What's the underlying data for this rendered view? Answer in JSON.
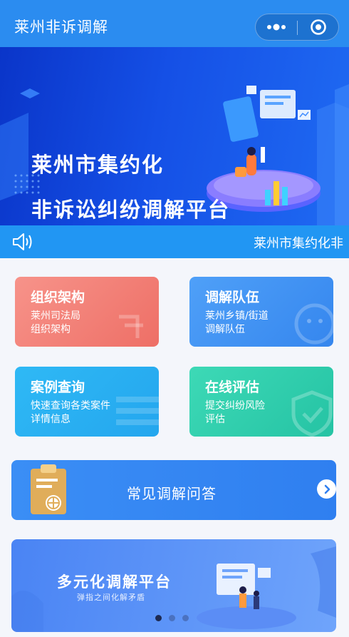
{
  "header": {
    "title": "莱州非诉调解"
  },
  "capsule": {
    "more_icon": "more-dots-icon",
    "close_icon": "target-close-icon"
  },
  "banner": {
    "line1": "莱州市集约化",
    "line2": "非诉讼纠纷调解平台"
  },
  "notice": {
    "icon": "speaker-icon",
    "text": "莱州市集约化非"
  },
  "cards": [
    {
      "title": "组织架构",
      "desc1": "莱州司法局",
      "desc2": "组织架构",
      "color": "#f07c72"
    },
    {
      "title": "调解队伍",
      "desc1": "莱州乡镇/街道",
      "desc2": "调解队伍",
      "color": "#3a8bf0"
    },
    {
      "title": "案例查询",
      "desc1": "快速查询各类案件",
      "desc2": "详情信息",
      "color": "#28aff0"
    },
    {
      "title": "在线评估",
      "desc1": "提交纠纷风险",
      "desc2": "评估",
      "color": "#2ecbaa"
    }
  ],
  "faq": {
    "label": "常见调解问答",
    "icon": "clipboard-globe-icon",
    "arrow_icon": "chevron-right-icon"
  },
  "promo": {
    "title": "多元化调解平台",
    "subtitle": "弹指之间化解矛盾",
    "slide_count": 3,
    "active_slide": 1
  },
  "colors": {
    "header": "#2b8cf0",
    "notice": "#2196f3",
    "banner": "#1550e6"
  }
}
